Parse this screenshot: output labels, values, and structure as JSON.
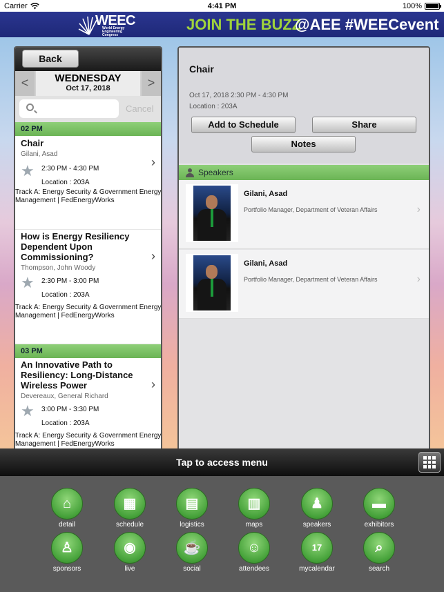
{
  "status": {
    "carrier": "Carrier",
    "time": "4:41 PM",
    "battery": "100%"
  },
  "banner": {
    "logo_big": "WEEC",
    "logo_small": "World Energy Engineering Congress",
    "tagline": "JOIN THE BUZZ",
    "tagline2": "@AEE #WEECevent"
  },
  "left": {
    "back": "Back",
    "day": "WEDNESDAY",
    "date": "Oct 17, 2018",
    "prev": "<",
    "next": ">",
    "search_placeholder": "",
    "cancel": "Cancel",
    "hours": [
      "02 PM",
      "03 PM"
    ],
    "sessions": [
      {
        "title": "Chair",
        "speaker": "Gilani, Asad",
        "time": "2:30 PM - 4:30 PM",
        "location": "Location : 203A",
        "track": "Track A: Energy Security & Government Energy Management | FedEnergyWorks"
      },
      {
        "title": "How is Energy Resiliency Dependent Upon Commissioning?",
        "speaker": "Thompson, John Woody",
        "time": "2:30 PM - 3:00 PM",
        "location": "Location : 203A",
        "track": "Track A: Energy Security & Government Energy Management | FedEnergyWorks"
      },
      {
        "title": "An Innovative Path to Resiliency: Long-Distance Wireless Power",
        "speaker": "Devereaux, General Richard",
        "time": "3:00 PM - 3:30 PM",
        "location": "Location : 203A",
        "track": "Track A: Energy Security & Government Energy Management | FedEnergyWorks"
      }
    ]
  },
  "detail": {
    "title": "Chair",
    "datetime": "Oct 17, 2018 2:30 PM - 4:30 PM",
    "location": "Location : 203A",
    "add": "Add to Schedule",
    "share": "Share",
    "notes": "Notes",
    "speakers_header": "Speakers",
    "speakers": [
      {
        "name": "Gilani, Asad",
        "role": "Portfolio Manager, Department of Veteran Affairs"
      },
      {
        "name": "Gilani, Asad",
        "role": "Portfolio Manager, Department of Veteran Affairs"
      }
    ]
  },
  "menubar": {
    "label": "Tap to access menu"
  },
  "menu": [
    {
      "label": "detail",
      "icon": "home-icon"
    },
    {
      "label": "schedule",
      "icon": "calendar-grid-icon"
    },
    {
      "label": "logistics",
      "icon": "clipboard-icon"
    },
    {
      "label": "maps",
      "icon": "map-icon"
    },
    {
      "label": "speakers",
      "icon": "speaker-podium-icon"
    },
    {
      "label": "exhibitors",
      "icon": "briefcase-icon"
    },
    {
      "label": "sponsors",
      "icon": "sponsor-person-icon"
    },
    {
      "label": "live",
      "icon": "rss-icon"
    },
    {
      "label": "social",
      "icon": "coffee-cup-icon"
    },
    {
      "label": "attendees",
      "icon": "people-group-icon"
    },
    {
      "label": "mycalendar",
      "icon": "calendar-17-icon"
    },
    {
      "label": "search",
      "icon": "search-icon"
    }
  ],
  "colors": {
    "banner": "#2b3690",
    "accent_green": "#6bb455",
    "tagline": "#9fd23c",
    "menu_bg": "#5a5a5a"
  }
}
